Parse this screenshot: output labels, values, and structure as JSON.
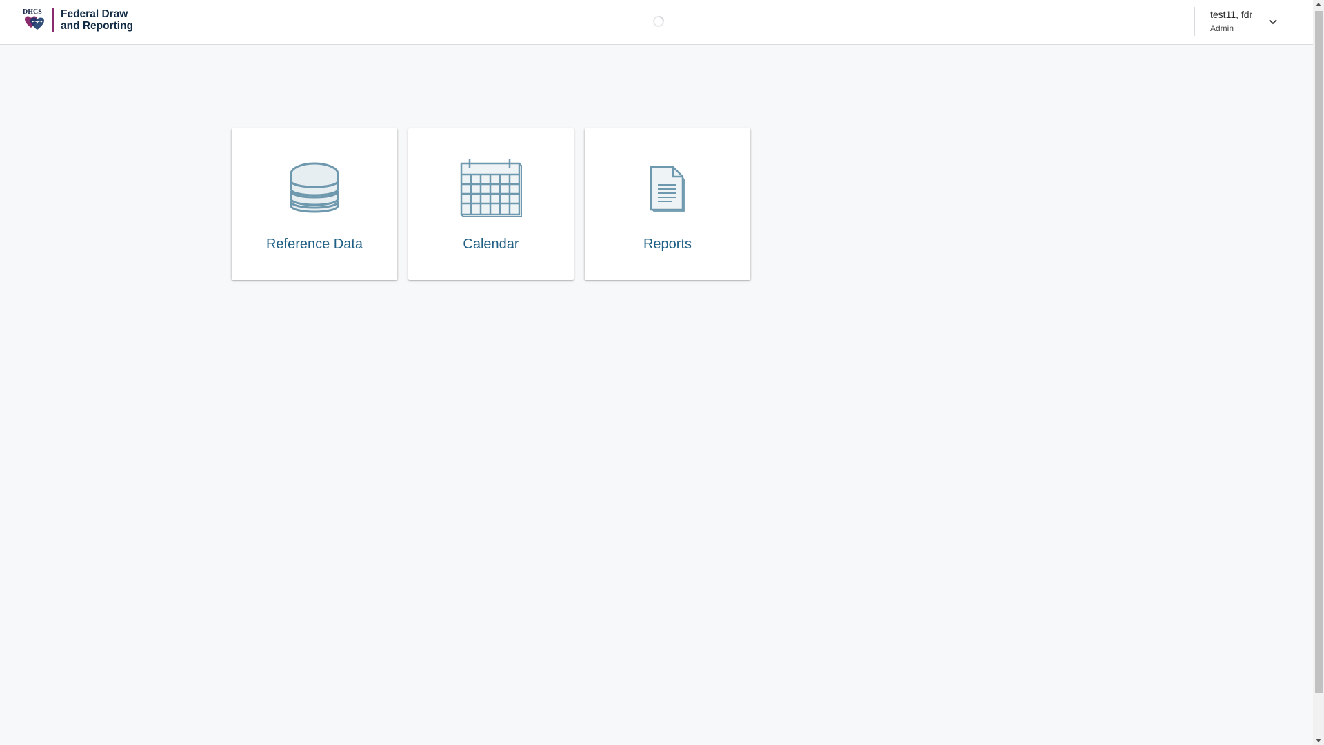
{
  "app": {
    "logo_line1": "Federal Draw",
    "logo_line2": "and Reporting",
    "brand_color": "#8a2b6e",
    "accent_color": "#1f5f85"
  },
  "user": {
    "name": "test11, fdr",
    "role": "Admin"
  },
  "tiles": [
    {
      "label": "Reference Data",
      "icon": "database-icon"
    },
    {
      "label": "Calendar",
      "icon": "calendar-icon"
    },
    {
      "label": "Reports",
      "icon": "document-icon"
    }
  ]
}
